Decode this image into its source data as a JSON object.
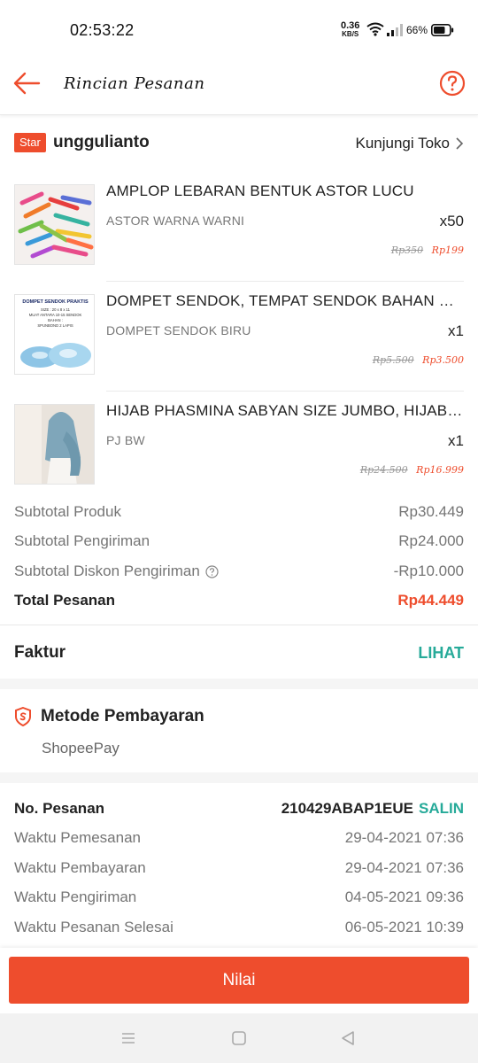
{
  "status_bar": {
    "time": "02:53:22",
    "net_speed": "0.36",
    "net_unit": "KB/S",
    "battery": "66%"
  },
  "header": {
    "title": "Rincian Pesanan"
  },
  "shop": {
    "badge": "Star",
    "name": "unggulianto",
    "visit_label": "Kunjungi Toko"
  },
  "products": [
    {
      "name": "AMPLOP LEBARAN BENTUK ASTOR LUCU",
      "variant": "ASTOR WARNA WARNI",
      "qty": "x50",
      "old_price": "Rp350",
      "new_price": "Rp199"
    },
    {
      "name": "DOMPET SENDOK, TEMPAT SENDOK BAHAN SPUNBOND",
      "variant": "DOMPET SENDOK BIRU",
      "qty": "x1",
      "old_price": "Rp5.500",
      "new_price": "Rp3.500"
    },
    {
      "name": "HIJAB PHASMINA SABYAN SIZE JUMBO, HIJAB PASHMINA",
      "variant": "PJ BW",
      "qty": "x1",
      "old_price": "Rp24.500",
      "new_price": "Rp16.999"
    }
  ],
  "summary": {
    "subtotal_product_label": "Subtotal Produk",
    "subtotal_product_value": "Rp30.449",
    "subtotal_shipping_label": "Subtotal Pengiriman",
    "subtotal_shipping_value": "Rp24.000",
    "shipping_discount_label": "Subtotal Diskon Pengiriman",
    "shipping_discount_value": "-Rp10.000",
    "total_label": "Total Pesanan",
    "total_value": "Rp44.449"
  },
  "invoice": {
    "label": "Faktur",
    "link": "LIHAT"
  },
  "payment": {
    "title": "Metode Pembayaran",
    "method": "ShopeePay"
  },
  "order_info": {
    "order_no_label": "No. Pesanan",
    "order_no_value": "210429ABAP1EUE",
    "copy_label": "SALIN",
    "rows": [
      {
        "label": "Waktu Pemesanan",
        "value": "29-04-2021 07:36"
      },
      {
        "label": "Waktu Pembayaran",
        "value": "29-04-2021 07:36"
      },
      {
        "label": "Waktu Pengiriman",
        "value": "04-05-2021 09:36"
      },
      {
        "label": "Waktu Pesanan Selesai",
        "value": "06-05-2021 10:39"
      }
    ]
  },
  "action": {
    "rate_label": "Nilai"
  },
  "thumb2_caption": {
    "line1": "DOMPET SENDOK PRAKTIS",
    "line2": "SIZE : 20 x 8 x 11",
    "line3": "MUAT ANTARA 10-15 SENDOK",
    "line4": "BAHAN :",
    "line5": "SPUNBOND 2 LAPIS"
  },
  "colors": {
    "brand": "#ee4d2d",
    "link": "#26aa99"
  },
  "icons": [
    "back-arrow-icon",
    "help-icon",
    "chevron-right-icon",
    "info-icon",
    "shield-icon",
    "wifi-icon",
    "signal-icon",
    "battery-icon",
    "menu-icon",
    "home-icon",
    "back-triangle-icon"
  ]
}
